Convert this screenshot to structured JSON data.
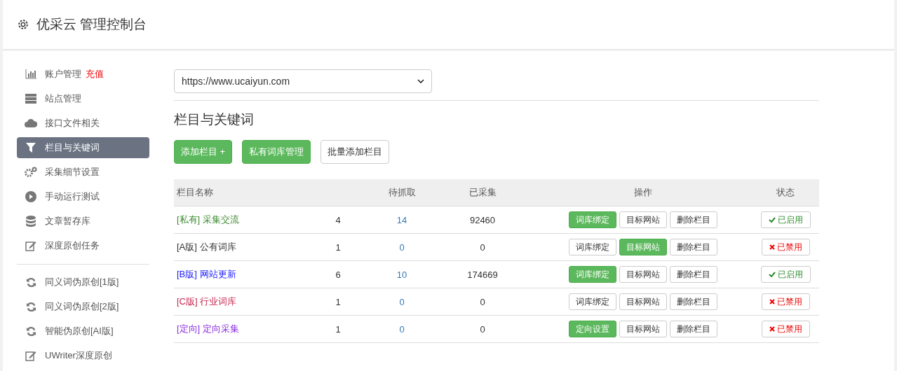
{
  "header": {
    "title": "优采云 管理控制台"
  },
  "sidebar": {
    "items": [
      {
        "label": "账户管理",
        "badge": "充值",
        "selected": false
      },
      {
        "label": "站点管理",
        "selected": false
      },
      {
        "label": "接口文件相关",
        "selected": false
      },
      {
        "label": "栏目与关键词",
        "selected": true
      },
      {
        "label": "采集细节设置",
        "selected": false
      },
      {
        "label": "手动运行测试",
        "selected": false
      },
      {
        "label": "文章暂存库",
        "selected": false
      },
      {
        "label": "深度原创任务",
        "selected": false
      }
    ],
    "tools": [
      "同义词伪原创[1版]",
      "同义词伪原创[2版]",
      "智能伪原创[AI版]",
      "UWriter深度原创"
    ]
  },
  "site_select": {
    "value": "https://www.ucaiyun.com"
  },
  "section_title": "栏目与关键词",
  "actions": [
    {
      "label": "添加栏目 +",
      "primary": true
    },
    {
      "label": "私有词库管理",
      "primary": true
    },
    {
      "label": "批量添加栏目",
      "primary": false
    }
  ],
  "table": {
    "columns": [
      "栏目名称",
      "",
      "待抓取",
      "已采集",
      "操作",
      "状态"
    ],
    "rows": [
      {
        "tag": "[私有]",
        "name": "采集交流",
        "color": "#3c8a2e",
        "count": "4",
        "pending": "14",
        "collected": "92460",
        "ops": [
          {
            "label": "词库绑定",
            "primary": true
          },
          {
            "label": "目标网站",
            "primary": false
          },
          {
            "label": "删除栏目",
            "primary": false
          }
        ],
        "status": {
          "label": "已启用",
          "enabled": true
        }
      },
      {
        "tag": "[A版]",
        "name": "公有词库",
        "color": "#333333",
        "count": "1",
        "pending": "0",
        "collected": "0",
        "ops": [
          {
            "label": "词库绑定",
            "primary": false
          },
          {
            "label": "目标网站",
            "primary": true
          },
          {
            "label": "删除栏目",
            "primary": false
          }
        ],
        "status": {
          "label": "已禁用",
          "enabled": false
        }
      },
      {
        "tag": "[B版]",
        "name": "网站更新",
        "color": "#1a1aff",
        "count": "6",
        "pending": "10",
        "collected": "174669",
        "ops": [
          {
            "label": "词库绑定",
            "primary": true
          },
          {
            "label": "目标网站",
            "primary": false
          },
          {
            "label": "删除栏目",
            "primary": false
          }
        ],
        "status": {
          "label": "已启用",
          "enabled": true
        }
      },
      {
        "tag": "[C版]",
        "name": "行业词库",
        "color": "#c7254e",
        "count": "1",
        "pending": "0",
        "collected": "0",
        "ops": [
          {
            "label": "词库绑定",
            "primary": false
          },
          {
            "label": "目标网站",
            "primary": false
          },
          {
            "label": "删除栏目",
            "primary": false
          }
        ],
        "status": {
          "label": "已禁用",
          "enabled": false
        }
      },
      {
        "tag": "[定向]",
        "name": "定向采集",
        "color": "#8a2be2",
        "count": "1",
        "pending": "0",
        "collected": "0",
        "ops": [
          {
            "label": "定向设置",
            "primary": true
          },
          {
            "label": "目标网站",
            "primary": false
          },
          {
            "label": "删除栏目",
            "primary": false
          }
        ],
        "status": {
          "label": "已禁用",
          "enabled": false
        }
      }
    ]
  }
}
